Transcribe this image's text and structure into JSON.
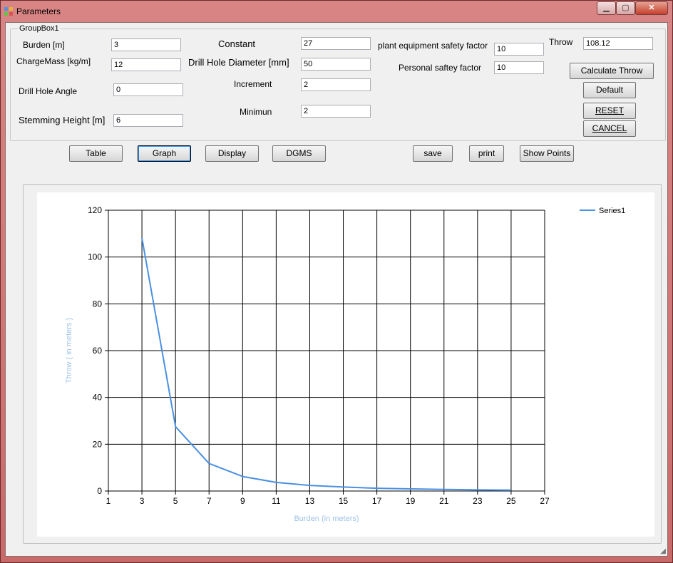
{
  "window": {
    "title": "Parameters",
    "minimize": "▁",
    "maximize": "▢",
    "close": "✕"
  },
  "groupbox": {
    "title": "GroupBox1"
  },
  "fields": {
    "burden": {
      "label": "Burden  [m]",
      "value": "3"
    },
    "charge_mass": {
      "label": "ChargeMass  [kg/m]",
      "value": "12"
    },
    "drill_hole_angle": {
      "label": "Drill Hole Angle",
      "value": "0"
    },
    "stemming_height": {
      "label": "Stemming Height [m]",
      "value": "6"
    },
    "constant": {
      "label": "Constant",
      "value": "27"
    },
    "drill_hole_diameter": {
      "label": "Drill Hole Diameter  [mm]",
      "value": "50"
    },
    "increment": {
      "label": "Increment",
      "value": "2"
    },
    "minimum": {
      "label": "Minimun",
      "value": "2"
    },
    "plant_safety": {
      "label": "plant equipment safety factor",
      "value": "10"
    },
    "personal_safety": {
      "label": "Personal saftey factor",
      "value": "10"
    },
    "throw": {
      "label": "Throw",
      "value": "108.12"
    }
  },
  "buttons": {
    "calculate_throw": "Calculate Throw",
    "default": "Default",
    "reset": "RESET",
    "cancel": "CANCEL",
    "table": "Table",
    "graph": "Graph",
    "display": "Display",
    "dgms": "DGMS",
    "save": "save",
    "print": "print",
    "show_points": "Show Points"
  },
  "chart_data": {
    "type": "line",
    "title": "",
    "xlabel": "Burden (in meters)",
    "ylabel": "Throw ( in meters )",
    "xlim": [
      1,
      27
    ],
    "ylim": [
      0,
      120
    ],
    "x_ticks": [
      1,
      3,
      5,
      7,
      9,
      11,
      13,
      15,
      17,
      19,
      21,
      23,
      25,
      27
    ],
    "y_ticks": [
      0,
      20,
      40,
      60,
      80,
      100,
      120
    ],
    "grid": true,
    "legend_position": "top-right",
    "series": [
      {
        "name": "Series1",
        "color": "#4a90e2",
        "x": [
          3,
          5,
          7,
          9,
          11,
          13,
          15,
          17,
          19,
          21,
          23,
          25
        ],
        "y": [
          108.12,
          27.5,
          11.8,
          6.2,
          3.7,
          2.4,
          1.7,
          1.2,
          0.9,
          0.7,
          0.5,
          0.4
        ]
      }
    ]
  }
}
